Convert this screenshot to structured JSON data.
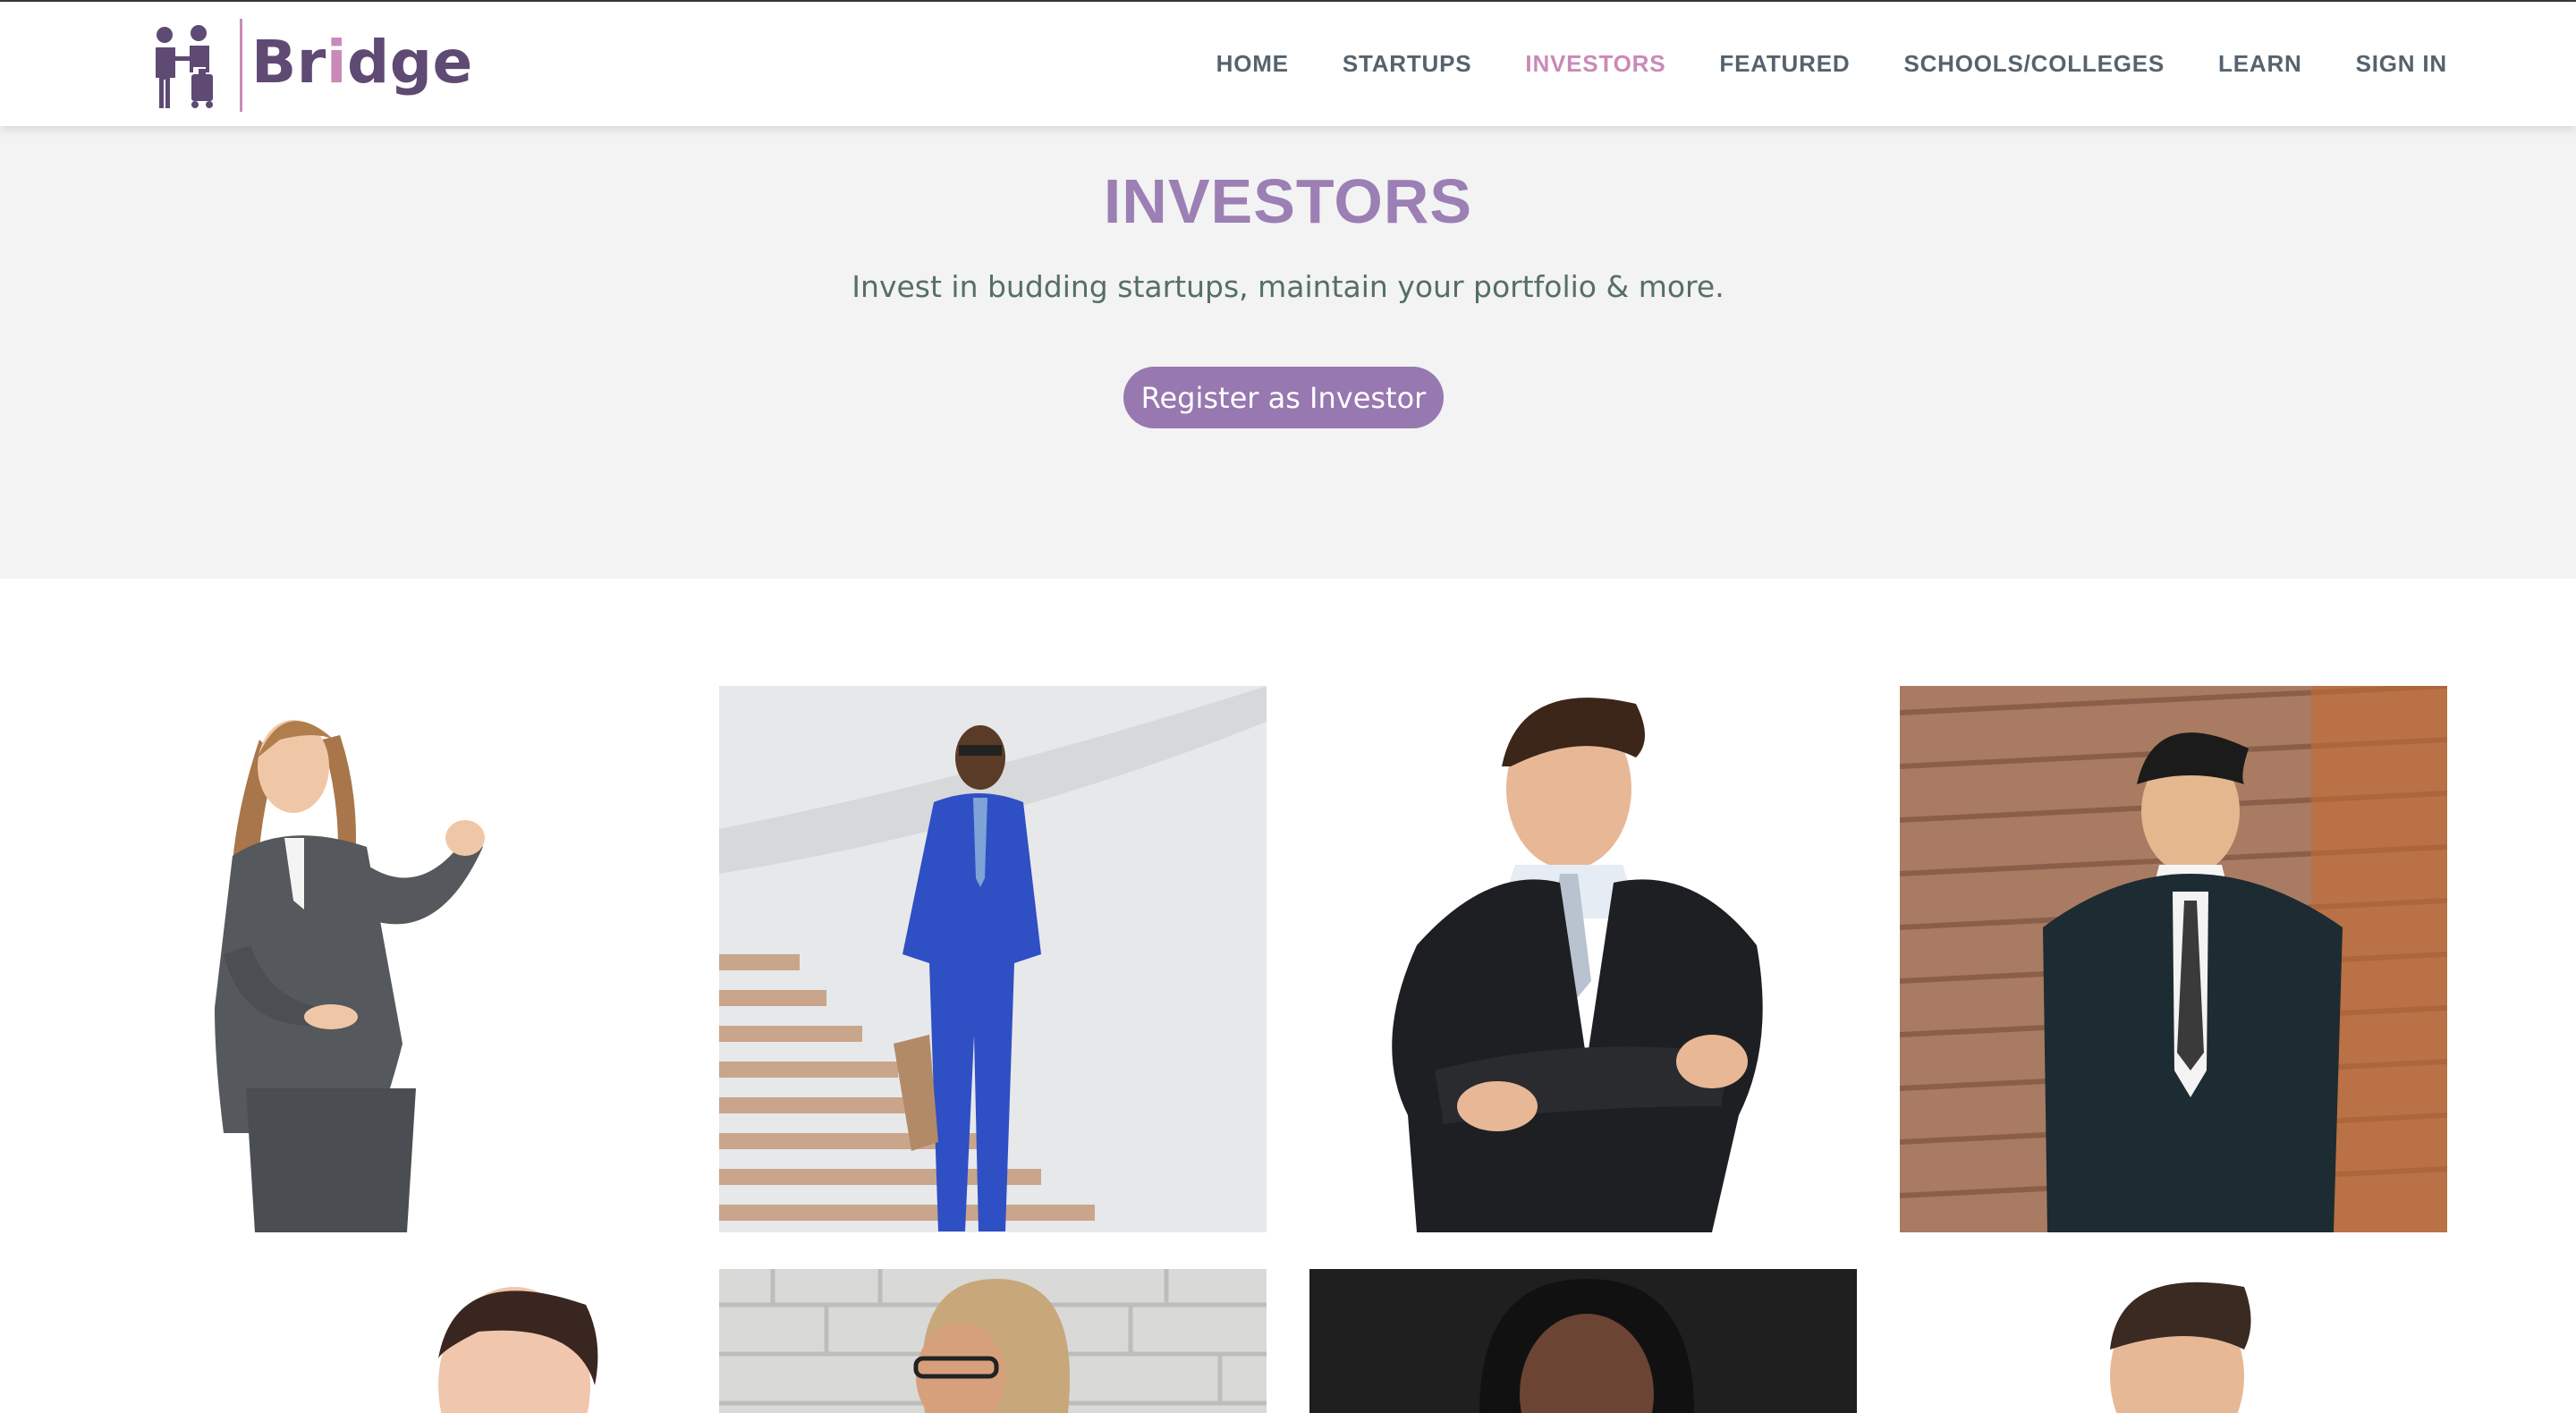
{
  "brand": {
    "name_prefix": "Br",
    "name_i": "i",
    "name_suffix": "dge",
    "accent": "#c98ab8",
    "color": "#5e4a72"
  },
  "nav": {
    "items": [
      {
        "label": "HOME",
        "active": false
      },
      {
        "label": "STARTUPS",
        "active": false
      },
      {
        "label": "INVESTORS",
        "active": true
      },
      {
        "label": "FEATURED",
        "active": false
      },
      {
        "label": "SCHOOLS/COLLEGES",
        "active": false
      },
      {
        "label": "LEARN",
        "active": false
      },
      {
        "label": "SIGN IN",
        "active": false
      }
    ]
  },
  "hero": {
    "title": "INVESTORS",
    "subtitle": "Invest in budding startups, maintain your portfolio & more.",
    "cta_label": "Register as Investor"
  },
  "gallery": {
    "investors": [
      {
        "photo": "woman-grey-suit-presenting"
      },
      {
        "photo": "man-blue-suit-on-stairs"
      },
      {
        "photo": "man-black-suit-arms-crossed"
      },
      {
        "photo": "man-navy-suit-wood-wall"
      },
      {
        "photo": "woman-dark-hair-portrait"
      },
      {
        "photo": "woman-glasses-brick-wall"
      },
      {
        "photo": "woman-dark-background-portrait"
      },
      {
        "photo": "man-short-hair-portrait"
      }
    ]
  },
  "colors": {
    "accent": "#c98ab8",
    "title": "#9c7fb4",
    "button": "#9778b0",
    "nav_text": "#56636e",
    "hero_bg": "#f2f3f2"
  }
}
